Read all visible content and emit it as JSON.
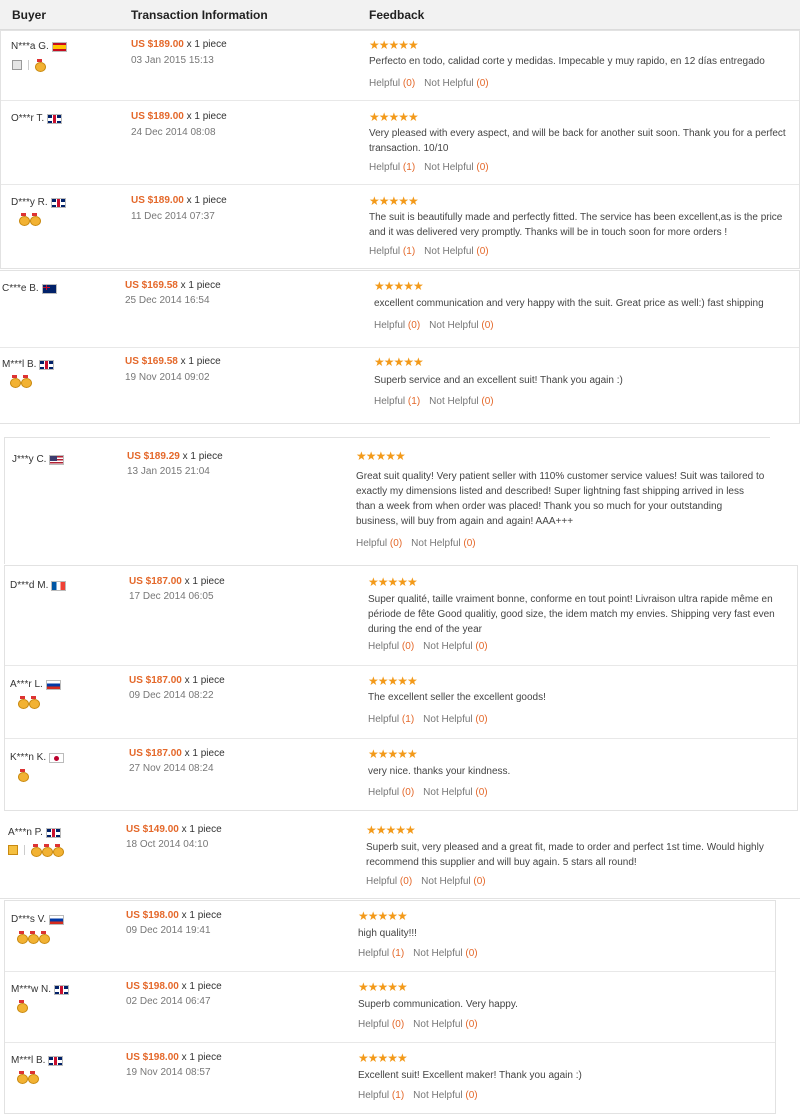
{
  "header": {
    "buyer": "Buyer",
    "transaction": "Transaction Information",
    "feedback": "Feedback"
  },
  "labels": {
    "helpful": "Helpful",
    "not_helpful": "Not Helpful",
    "qty": "x 1 piece"
  },
  "reviews": [
    {
      "buyer": "N***a G.",
      "country": "Spain",
      "price": "US $189.00",
      "date": "03 Jan 2015 15:13",
      "stars": "★★★★★",
      "comment": "Perfecto en todo, calidad corte y medidas. Impecable y muy rapido, en 12 días entregado",
      "helpful": "(0)",
      "not_helpful": "(0)"
    },
    {
      "buyer": "O***r T.",
      "country": "United Kingdom",
      "price": "US $189.00",
      "date": "24 Dec 2014 08:08",
      "stars": "★★★★★",
      "comment": "Very pleased with every aspect, and will be back for another suit soon. Thank you for a perfect transaction. 10/10",
      "helpful": "(1)",
      "not_helpful": "(0)"
    },
    {
      "buyer": "D***y R.",
      "country": "United Kingdom",
      "price": "US $189.00",
      "date": "11 Dec 2014 07:37",
      "stars": "★★★★★",
      "comment": "The suit is beautifully made and perfectly fitted. The service has been excellent,as is the price and it was delivered very promptly. Thanks will be in touch soon for more orders !",
      "helpful": "(1)",
      "not_helpful": "(0)"
    },
    {
      "buyer": "C***e B.",
      "country": "Australia",
      "price": "US $169.58",
      "date": "25 Dec 2014 16:54",
      "stars": "★★★★★",
      "comment": "excellent communication and very happy with the suit. Great price as well:) fast shipping",
      "helpful": "(0)",
      "not_helpful": "(0)"
    },
    {
      "buyer": "M***l B.",
      "country": "United Kingdom",
      "price": "US $169.58",
      "date": "19 Nov 2014 09:02",
      "stars": "★★★★★",
      "comment": "Superb service and an excellent suit! Thank you again :)",
      "helpful": "(1)",
      "not_helpful": "(0)"
    },
    {
      "buyer": "J***y C.",
      "country": "United States",
      "price": "US $189.29",
      "date": "13 Jan 2015 21:04",
      "stars": "★★★★★",
      "comment": "Great suit quality! Very patient seller with 110% customer service values! Suit was tailored to exactly my dimensions listed and described! Super lightning fast shipping arrived in less than a week from when order was placed! Thank you so much for your outstanding business, will buy from again and again! AAA+++",
      "helpful": "(0)",
      "not_helpful": "(0)"
    },
    {
      "buyer": "D***d M.",
      "country": "France",
      "price": "US $187.00",
      "date": "17 Dec 2014 06:05",
      "stars": "★★★★★",
      "comment": "Super qualité, taille vraiment bonne, conforme en tout point! Livraison ultra rapide même en période de fête Good qualitiy, good size, the idem match my envies. Shipping very fast even during the end of the year",
      "helpful": "(0)",
      "not_helpful": "(0)"
    },
    {
      "buyer": "A***r L.",
      "country": "Russia",
      "price": "US $187.00",
      "date": "09 Dec 2014 08:22",
      "stars": "★★★★★",
      "comment": "The excellent seller the excellent goods!",
      "helpful": "(1)",
      "not_helpful": "(0)"
    },
    {
      "buyer": "K***n K.",
      "country": "Japan",
      "price": "US $187.00",
      "date": "27 Nov 2014 08:24",
      "stars": "★★★★★",
      "comment": "very nice. thanks your kindness.",
      "helpful": "(0)",
      "not_helpful": "(0)"
    },
    {
      "buyer": "A***n P.",
      "country": "United Kingdom",
      "price": "US $149.00",
      "date": "18 Oct 2014 04:10",
      "stars": "★★★★★",
      "comment": "Superb suit, very pleased and a great fit, made to order and perfect 1st time. Would highly recommend this supplier and will buy again. 5 stars all round!",
      "helpful": "(0)",
      "not_helpful": "(0)"
    },
    {
      "buyer": "D***s V.",
      "country": "Russia",
      "price": "US $198.00",
      "date": "09 Dec 2014 19:41",
      "stars": "★★★★★",
      "comment": "high quality!!!",
      "helpful": "(1)",
      "not_helpful": "(0)"
    },
    {
      "buyer": "M***w N.",
      "country": "United Kingdom",
      "price": "US $198.00",
      "date": "02 Dec 2014 06:47",
      "stars": "★★★★★",
      "comment": "Superb communication. Very happy.",
      "helpful": "(0)",
      "not_helpful": "(0)"
    },
    {
      "buyer": "M***l B.",
      "country": "United Kingdom",
      "price": "US $198.00",
      "date": "19 Nov 2014 08:57",
      "stars": "★★★★★",
      "comment": "Excellent suit! Excellent maker! Thank you again :)",
      "helpful": "(1)",
      "not_helpful": "(0)"
    }
  ]
}
